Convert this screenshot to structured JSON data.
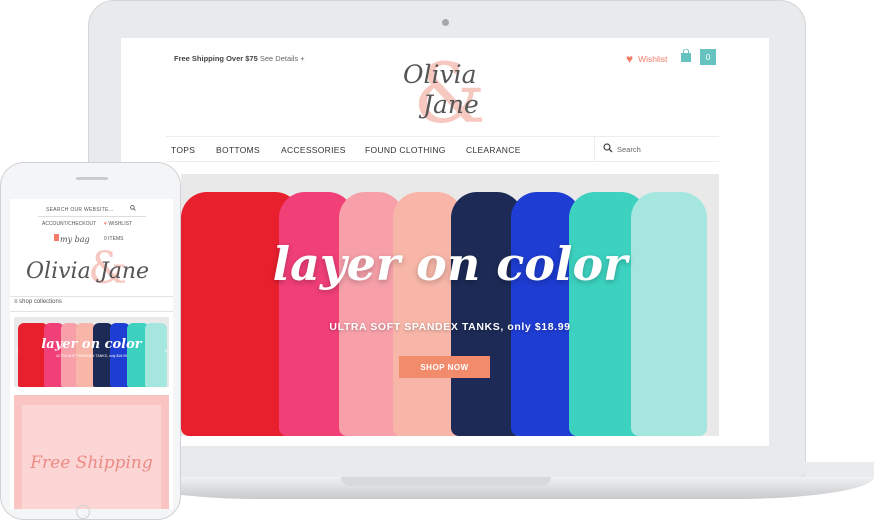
{
  "desktop": {
    "shipping_text": "Free Shipping Over $75",
    "shipping_link": "See Details +",
    "wishlist": "Wishlist",
    "cart_count": "0",
    "logo_line1": "Olivia",
    "logo_line2": "Jane",
    "logo_amp": "&",
    "nav": [
      "TOPS",
      "BOTTOMS",
      "ACCESSORIES",
      "FOUND CLOTHING",
      "CLEARANCE"
    ],
    "search_placeholder": "Search",
    "hero_title": "layer on color",
    "hero_subtitle": "ULTRA SOFT SPANDEX TANKS, only $18.99",
    "hero_button": "SHOP NOW"
  },
  "mobile": {
    "search_placeholder": "SEARCH OUR WEBSITE...",
    "account_link": "ACCOUNT/CHECKOUT",
    "wishlist_link": "WISHLIST",
    "bag_label": "my bag",
    "bag_items": "0 ITEMS",
    "logo": "Olivia",
    "logo2": "Jane",
    "logo_amp": "&",
    "collections": "≡ shop collections",
    "hero_title": "layer on color",
    "hero_subtitle": "ULTRA SOFT SPANDEX TANKS, only $18.99",
    "free_shipping": "Free Shipping"
  },
  "tank_colors": [
    "#e8202d",
    "#f13f78",
    "#f7a0aa",
    "#f7b6a8",
    "#1c2a55",
    "#1e3dd2",
    "#3dd2c0",
    "#a5e6df"
  ]
}
